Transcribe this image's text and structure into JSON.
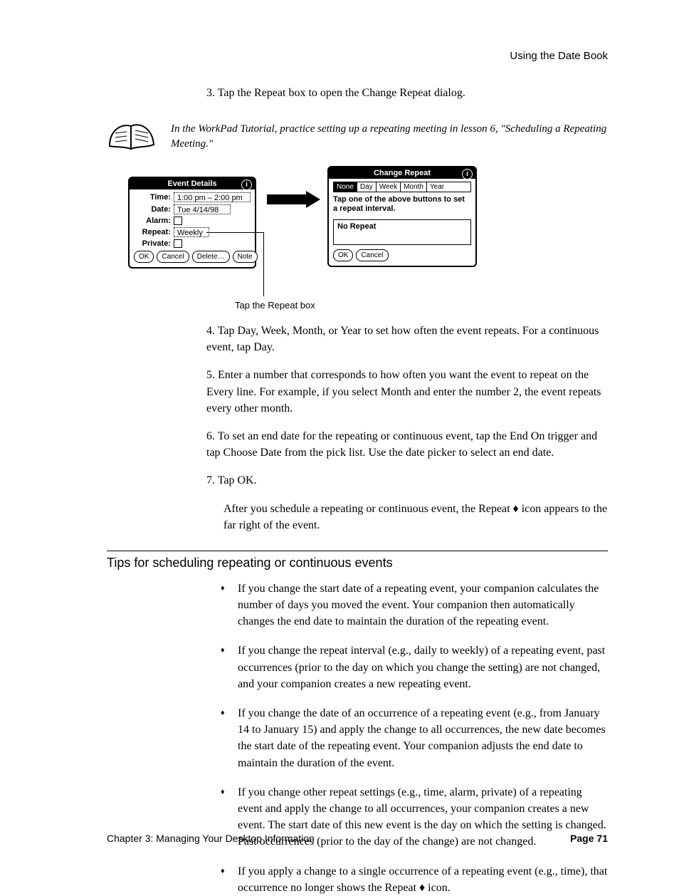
{
  "page_header": "Using the Date Book",
  "intro_line": "3. Tap the Repeat box to open the Change Repeat dialog.",
  "book_caption": "In the WorkPad Tutorial, practice setting up a repeating meeting in lesson 6, \"Scheduling a Repeating Meeting.\"",
  "callout": "Tap the Repeat box",
  "event_details": {
    "title": "Event Details",
    "labels": {
      "time": "Time:",
      "date": "Date:",
      "alarm": "Alarm:",
      "repeat": "Repeat:",
      "private": "Private:"
    },
    "time_value": "1:00 pm – 2:00 pm",
    "date_value": "Tue 4/14/98",
    "repeat_value": "Weekly",
    "buttons": {
      "ok": "OK",
      "cancel": "Cancel",
      "delete": "Delete…",
      "note": "Note"
    }
  },
  "change_repeat": {
    "title": "Change Repeat",
    "options": [
      "None",
      "Day",
      "Week",
      "Month",
      "Year"
    ],
    "msg": "Tap one of the above buttons to set a repeat interval.",
    "box_text": "No Repeat",
    "buttons": {
      "ok": "OK",
      "cancel": "Cancel"
    }
  },
  "step4": "4. Tap Day, Week, Month, or Year to set how often the event repeats. For a continuous event, tap Day.",
  "step5": "5. Enter a number that corresponds to how often you want the event to repeat on the Every line. For example, if you select Month and enter the number 2, the event repeats every other month.",
  "step6": "6. To set an end date for the repeating or continuous event, tap the End On trigger and tap Choose Date from the pick list. Use the date picker to select an end date.",
  "step7": "7. Tap OK.",
  "after_ok": "After you schedule a repeating or continuous event, the Repeat ♦ icon appears to the far right of the event.",
  "section_head": "Tips for scheduling repeating or continuous events",
  "tips": [
    "If you change the start date of a repeating event, your companion calculates the number of days you moved the event. Your companion then automatically changes the end date to maintain the duration of the repeating event.",
    "If you change the repeat interval (e.g., daily to weekly) of a repeating event, past occurrences (prior to the day on which you change the setting) are not changed, and your companion creates a new repeating event.",
    "If you change the date of an occurrence of a repeating event (e.g., from January 14 to January 15) and apply the change to all occurrences, the new date becomes the start date of the repeating event. Your companion adjusts the end date to maintain the duration of the event.",
    "If you change other repeat settings (e.g., time, alarm, private) of a repeating event and apply the change to all occurrences, your companion creates a new event. The start date of this new event is the day on which the setting is changed. Past occurrences (prior to the day of the change) are not changed.",
    "If you apply a change to a single occurrence of a repeating event (e.g., time), that occurrence no longer shows the Repeat ♦ icon."
  ],
  "footer_left": "Chapter 3: Managing Your Desktop Information",
  "footer_right": "Page 71"
}
